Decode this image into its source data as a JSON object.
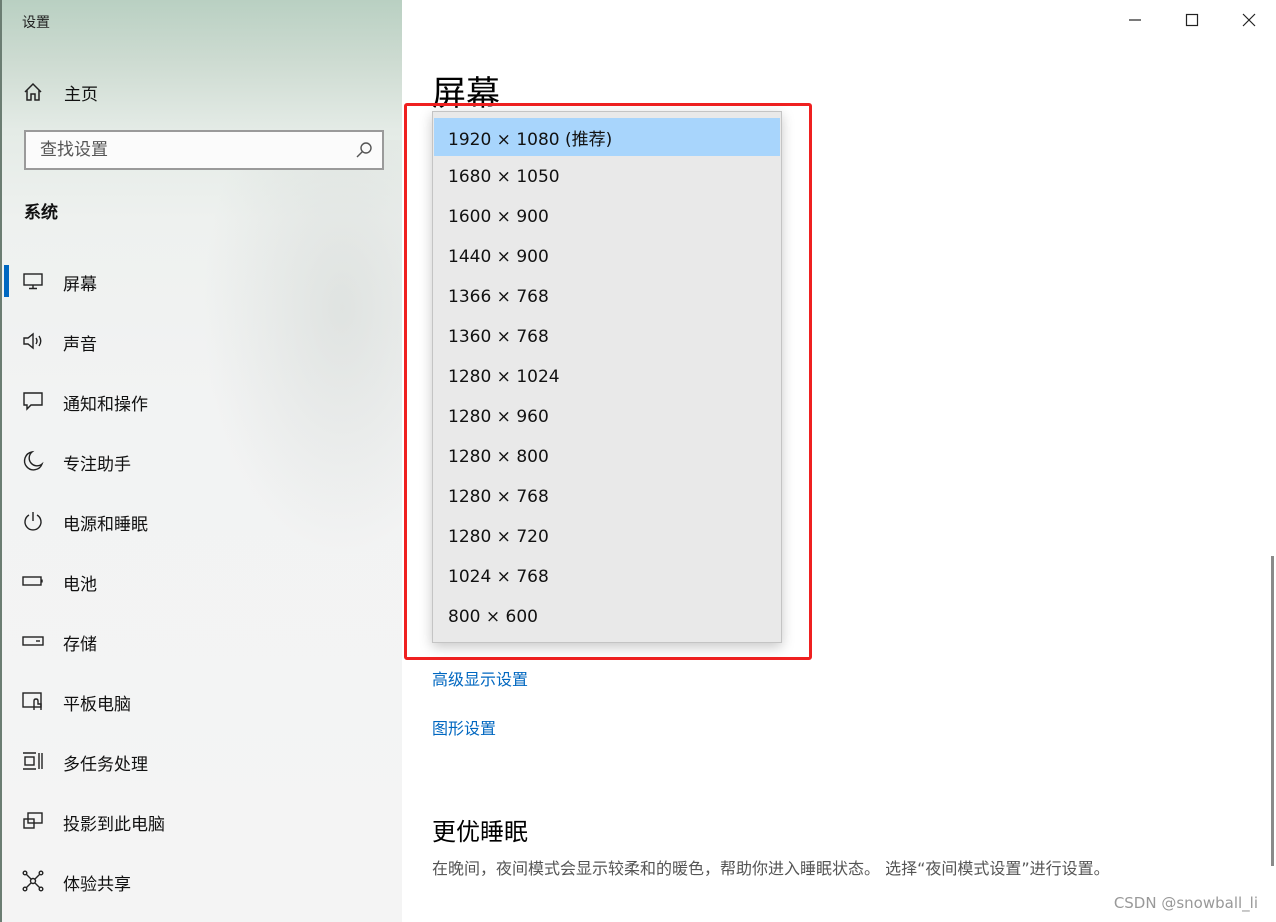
{
  "window": {
    "title": "设置"
  },
  "sidebar": {
    "home_label": "主页",
    "search_placeholder": "查找设置",
    "section": "系统",
    "items": [
      {
        "label": "屏幕",
        "icon": "monitor-icon"
      },
      {
        "label": "声音",
        "icon": "speaker-icon"
      },
      {
        "label": "通知和操作",
        "icon": "notification-icon"
      },
      {
        "label": "专注助手",
        "icon": "moon-icon"
      },
      {
        "label": "电源和睡眠",
        "icon": "power-icon"
      },
      {
        "label": "电池",
        "icon": "battery-icon"
      },
      {
        "label": "存储",
        "icon": "storage-icon"
      },
      {
        "label": "平板电脑",
        "icon": "tablet-icon"
      },
      {
        "label": "多任务处理",
        "icon": "multitask-icon"
      },
      {
        "label": "投影到此电脑",
        "icon": "project-icon"
      },
      {
        "label": "体验共享",
        "icon": "share-icon"
      }
    ]
  },
  "main": {
    "title": "屏幕",
    "resolution_options": [
      "1920 × 1080 (推荐)",
      "1680 × 1050",
      "1600 × 900",
      "1440 × 900",
      "1366 × 768",
      "1360 × 768",
      "1280 × 1024",
      "1280 × 960",
      "1280 × 800",
      "1280 × 768",
      "1280 × 720",
      "1024 × 768",
      "800 × 600"
    ],
    "selected_option": "1920 × 1080 (推荐)",
    "advanced_link": "高级显示设置",
    "graphics_link": "图形设置",
    "sleep_heading": "更优睡眠",
    "sleep_desc": "在晚间，夜间模式会显示较柔和的暖色，帮助你进入睡眠状态。 选择“夜间模式设置”进行设置。"
  },
  "watermark": "CSDN @snowball_li",
  "colors": {
    "accent": "#0067c0",
    "selection": "#a8d5fc",
    "highlight_box": "#ef2020"
  }
}
